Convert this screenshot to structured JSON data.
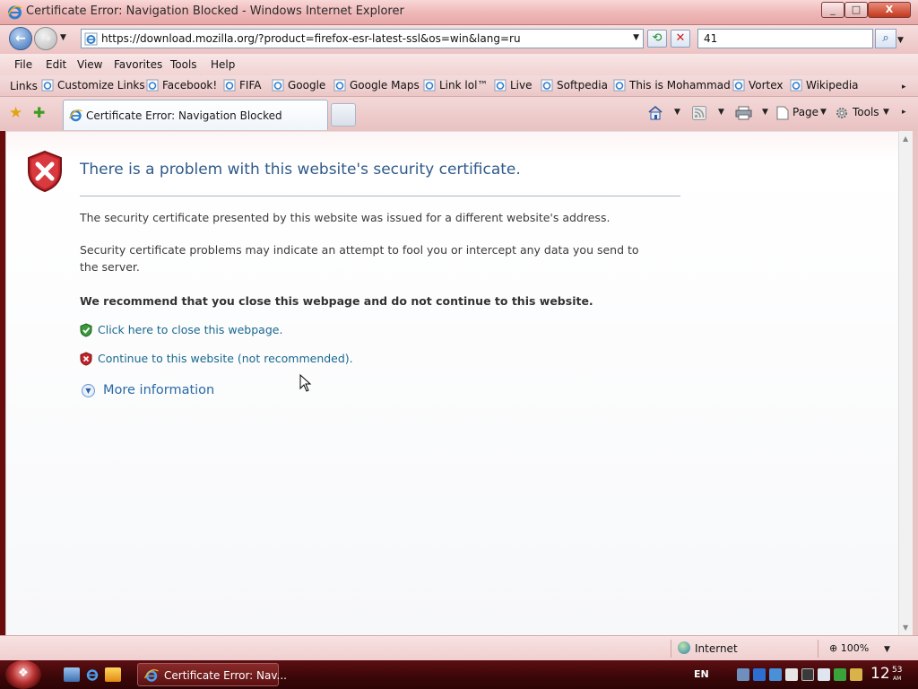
{
  "window": {
    "title": "Certificate Error: Navigation Blocked - Windows Internet Explorer",
    "minimize_glyph": "_",
    "maximize_glyph": "□",
    "close_glyph": "X"
  },
  "navigation": {
    "url": "https://download.mozilla.org/?product=firefox-esr-latest-ssl&os=win&lang=ru",
    "search_value": "41",
    "back_glyph": "←",
    "forward_glyph": "→",
    "refresh_glyph": "⟲",
    "stop_glyph": "✕",
    "search_glyph": "⌕"
  },
  "menu": [
    "File",
    "Edit",
    "View",
    "Favorites",
    "Tools",
    "Help"
  ],
  "links_bar": {
    "label": "Links",
    "items": [
      "Customize Links",
      "Facebook!",
      "FIFA",
      "Google",
      "Google Maps",
      "Link lol™",
      "Live",
      "Softpedia",
      "This is Mohammad",
      "Vortex",
      "Wikipedia"
    ]
  },
  "tabs": {
    "active_label": "Certificate Error: Navigation Blocked"
  },
  "command_bar": {
    "page_label": "Page",
    "tools_label": "Tools"
  },
  "error_page": {
    "heading": "There is a problem with this website's security certificate.",
    "paragraph1": "The security certificate presented by this website was issued for a different website's address.",
    "paragraph2": "Security certificate problems may indicate an attempt to fool you or intercept any data you send to the server.",
    "recommendation": "We recommend that you close this webpage and do not continue to this website.",
    "close_link": "Click here to close this webpage.",
    "continue_link": "Continue to this website (not recommended).",
    "more_info": "More information"
  },
  "status_bar": {
    "zone": "Internet",
    "zoom": "100%"
  },
  "taskbar": {
    "task_label": "Certificate Error: Nav...",
    "language": "EN",
    "clock_hour": "12",
    "clock_minute": "53",
    "clock_ampm": "AM"
  },
  "colors": {
    "heading": "#2f5a8a",
    "link": "#17688f",
    "error_shield": "#c0262c",
    "safe_shield": "#3a9a3a"
  },
  "icons": {
    "page": "ie-page-icon",
    "error": "red-shield-x-icon",
    "safe": "green-shield-check-icon"
  }
}
